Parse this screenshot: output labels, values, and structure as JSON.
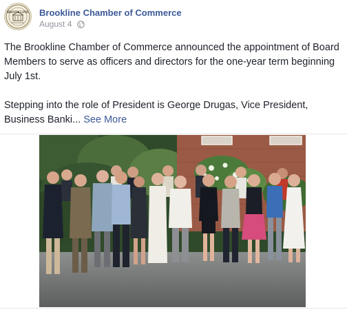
{
  "post": {
    "page_name": "Brookline Chamber of Commerce",
    "date": "August 4",
    "avatar_icon": "brookline-seal-logo",
    "privacy_icon": "globe-icon",
    "paragraphs": [
      "The Brookline Chamber of Commerce announced the appointment of Board Members to serve as officers and directors for the one-year term beginning July 1st.",
      "Stepping into the role of President is George Drugas, Vice President, Business Banki..."
    ],
    "see_more": "See More",
    "photo": {
      "subject": "group-photo-board-members",
      "people_count": 20
    }
  },
  "colors": {
    "link": "#3b5998",
    "text": "#1d2129",
    "meta": "#90949c"
  }
}
